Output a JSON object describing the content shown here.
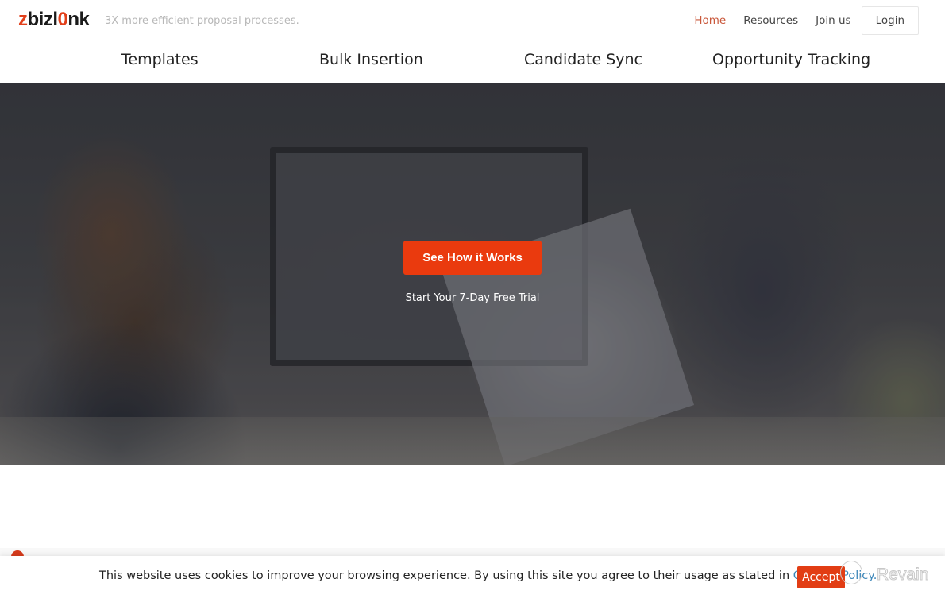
{
  "header": {
    "logo_text": "zbizlink",
    "tagline": "3X more efficient proposal processes.",
    "nav": [
      {
        "label": "Home",
        "active": true
      },
      {
        "label": "Resources",
        "active": false
      },
      {
        "label": "Join us",
        "active": false
      }
    ],
    "login_label": "Login"
  },
  "subnav": {
    "items": [
      "Templates",
      "Bulk Insertion",
      "Candidate Sync",
      "Opportunity Tracking"
    ]
  },
  "hero": {
    "cta_label": "See How it Works",
    "trial_text": "Start Your 7-Day Free Trial"
  },
  "cookie_bar": {
    "text": "This website uses cookies to improve your browsing experience. By using this site you agree to their usage as stated in ",
    "policy_link": "Cookies Policy.",
    "accept_label": "Accept"
  },
  "watermark": {
    "text": "Revain",
    "icon": "revain-logo-icon"
  },
  "colors": {
    "brand": "#e2401b",
    "cta": "#ea3a0e",
    "link": "#3a85b8",
    "nav_active": "#c9573a"
  }
}
